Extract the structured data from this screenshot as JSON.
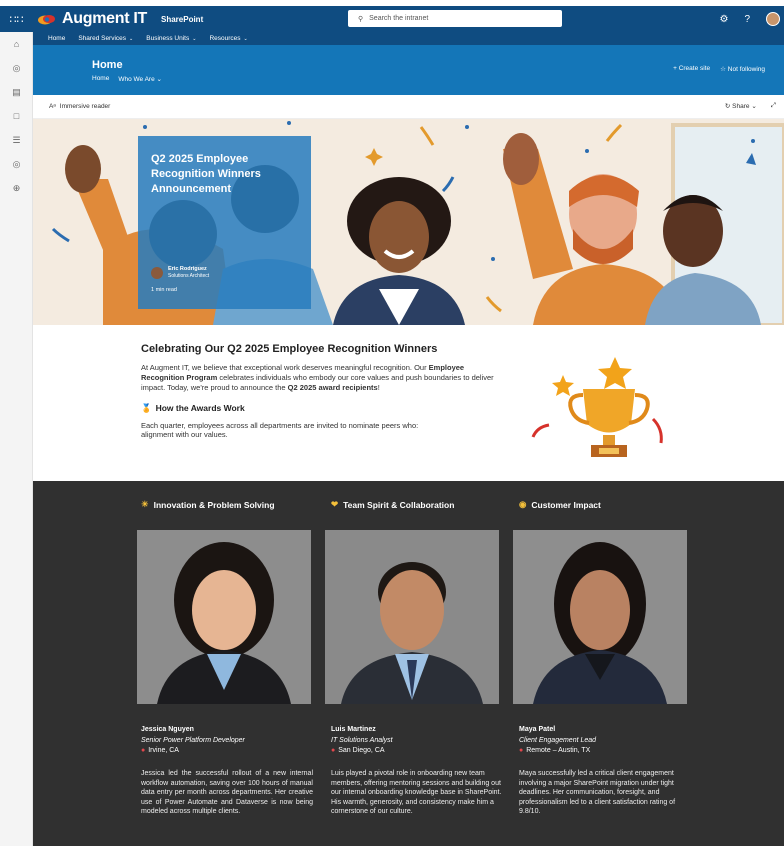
{
  "brand": {
    "name": "Augment IT",
    "app": "SharePoint"
  },
  "search": {
    "placeholder": "Search the intranet"
  },
  "hubnav": [
    {
      "label": "Home"
    },
    {
      "label": "Shared Services"
    },
    {
      "label": "Business Units"
    },
    {
      "label": "Resources"
    }
  ],
  "site": {
    "title": "Home",
    "nav": [
      "Home",
      "Who We Are"
    ],
    "create_site": "Create site",
    "follow": "Not following"
  },
  "commandbar": {
    "immersive": "Immersive reader",
    "share": "Share"
  },
  "hero": {
    "title": "Q2 2025 Employee Recognition Winners Announcement",
    "author": "Eric Rodriguez",
    "author_role": "Solutions Architect",
    "read_time": "1 min read"
  },
  "intro": {
    "title": "Celebrating Our Q2 2025 Employee Recognition Winners",
    "p1": "At Augment IT, we believe that exceptional work deserves meaningful recognition. Our ",
    "p1_bold": "Employee Recognition Program",
    "p2": " celebrates individuals who embody our core values and push boundaries to deliver impact. Today, we're proud to announce the ",
    "p2_bold": "Q2 2025 award recipients",
    "p3": "!",
    "awards_heading": "How the Awards Work",
    "awards_body": "Each quarter, employees across all departments are invited to nominate peers who: alignment with our values."
  },
  "winners": [
    {
      "category": "Innovation & Problem Solving",
      "name": "Jessica Nguyen",
      "role": "Senior Power Platform Developer",
      "location": "Irvine, CA",
      "description": "Jessica led the successful rollout of a new internal workflow automation, saving over 100 hours of manual data entry per month across departments. Her creative use of Power Automate and Dataverse is now being modeled across multiple clients."
    },
    {
      "category": "Team Spirit & Collaboration",
      "name": "Luis Martinez",
      "role": "IT Solutions Analyst",
      "location": "San Diego, CA",
      "description": "Luis played a pivotal role in onboarding new team members, offering mentoring sessions and building out our internal onboarding knowledge base in SharePoint. His warmth, generosity, and consistency make him a cornerstone of our culture."
    },
    {
      "category": "Customer Impact",
      "name": "Maya Patel",
      "role": "Client Engagement Lead",
      "location": "Remote – Austin, TX",
      "description": "Maya successfully led a critical client engagement involving a major SharePoint migration under tight deadlines. Her communication, foresight, and professionalism led to a client satisfaction rating of 9.8/10."
    }
  ]
}
